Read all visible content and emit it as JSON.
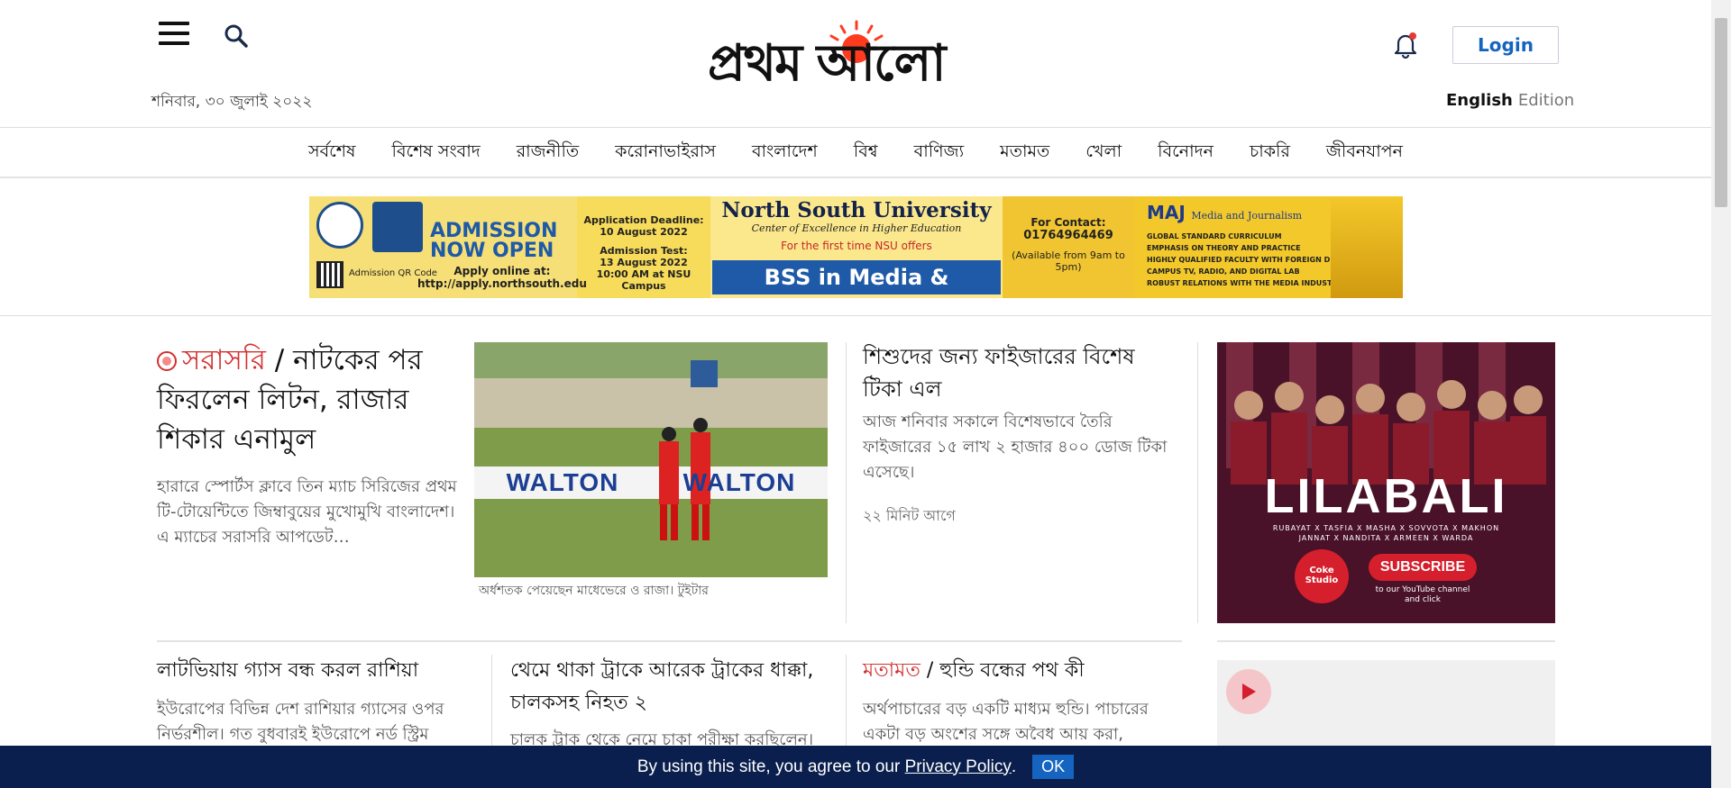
{
  "header": {
    "date": "শনিবার, ৩০ জুলাই ২০২২",
    "logo_text": "প্রথম আলো",
    "login_label": "Login",
    "edition_lang": "English",
    "edition_label": "Edition"
  },
  "nav": {
    "items": [
      "সর্বশেষ",
      "বিশেষ সংবাদ",
      "রাজনীতি",
      "করোনাভাইরাস",
      "বাংলাদেশ",
      "বিশ্ব",
      "বাণিজ্য",
      "মতামত",
      "খেলা",
      "বিনোদন",
      "চাকরি",
      "জীবনযাপন"
    ]
  },
  "ad_banner": {
    "admission_title_1": "ADMISSION",
    "admission_title_2": "NOW OPEN",
    "apply_label": "Apply online at:",
    "apply_url": "http://apply.northsouth.edu",
    "qr_label": "Admission QR Code",
    "deadline_label": "Application Deadline:",
    "deadline_date": "10 August 2022",
    "test_label": "Admission Test:",
    "test_date": "13 August 2022",
    "test_time": "10:00 AM at NSU Campus",
    "university": "North South University",
    "tagline": "Center of Excellence in Higher Education",
    "first_time": "For the first time NSU offers",
    "program": "BSS in Media & Journalism",
    "contact_label": "For Contact:",
    "contact_phone": "01764964469",
    "contact_hours": "(Available from 9am to 5pm)",
    "maj_title": "MAJ",
    "maj_subtitle": "Media and Journalism",
    "maj_points": [
      "GLOBAL STANDARD CURRICULUM",
      "EMPHASIS ON THEORY AND PRACTICE",
      "HIGHLY QUALIFIED FACULTY WITH FOREIGN DEGREES",
      "CAMPUS TV, RADIO, AND DIGITAL LAB",
      "ROBUST RELATIONS WITH THE MEDIA INDUSTRY"
    ]
  },
  "lead": {
    "live_label": "সরাসরি",
    "separator": "/",
    "title": "নাটকের পর ফিরলেন লিটন, রাজার শিকার এনামুল",
    "summary": "হারারে স্পোর্টস ক্লাবে তিন ম্যাচ সিরিজের প্রথম টি-টোয়েন্টিতে জিম্বাবুয়ের মুখোমুখি বাংলাদেশ। এ ম্যাচের সরাসরি আপডেট…",
    "image_banner": "WALTON",
    "image_caption": "অর্ধশতক পেয়েছেন মাধেভেরে ও রাজা। টুইটার"
  },
  "story2": {
    "title": "শিশুদের জন্য ফাইজারের বিশেষ টিকা এল",
    "summary": "আজ শনিবার সকালে বিশেষভাবে তৈরি ফাইজারের ১৫ লাখ ২ হাজার ৪০০ ডোজ টিকা এসেছে।",
    "time": "২২ মিনিট আগে"
  },
  "row": [
    {
      "title": "লাটভিয়ায় গ্যাস বন্ধ করল রাশিয়া",
      "summary": "ইউরোপের বিভিন্ন দেশ রাশিয়ার গ্যাসের ওপর নির্ভরশীল। গত বুধবারই ইউরোপে নর্ড স্ট্রিম"
    },
    {
      "title": "থেমে থাকা ট্রাকে আরেক ট্রাকের ধাক্কা, চালকসহ নিহত ২",
      "summary": "চালক ট্রাক থেকে নেমে চাকা পরীক্ষা করছিলেন।"
    },
    {
      "category": "মতামত",
      "separator": "/",
      "title": "হুন্ডি বন্ধের পথ কী",
      "summary": "অর্থপাচারের বড় একটি মাধ্যম হুন্ডি। পাচারের একটা বড় অংশের সঙ্গে অবৈধ আয় করা,"
    }
  ],
  "side_ad": {
    "title": "LILABALI",
    "artists_1": "RUBAYAT X TASFIA X MASHA X SOVVOTA X MAKHON",
    "artists_2": "JANNAT X NANDITA X ARMEEN X WARDA",
    "brand": "Coke Studio",
    "subscribe": "SUBSCRIBE",
    "subscribe_sub": "to our YouTube channel and click"
  },
  "cookie": {
    "text": "By using this site, you agree to our",
    "link": "Privacy Policy",
    "period": ".",
    "ok": "OK"
  },
  "colors": {
    "accent_red": "#d32f2f",
    "link_blue": "#1565c0",
    "cookie_bg": "#0a1f4d",
    "logo_sun": "#ff3b1f"
  }
}
